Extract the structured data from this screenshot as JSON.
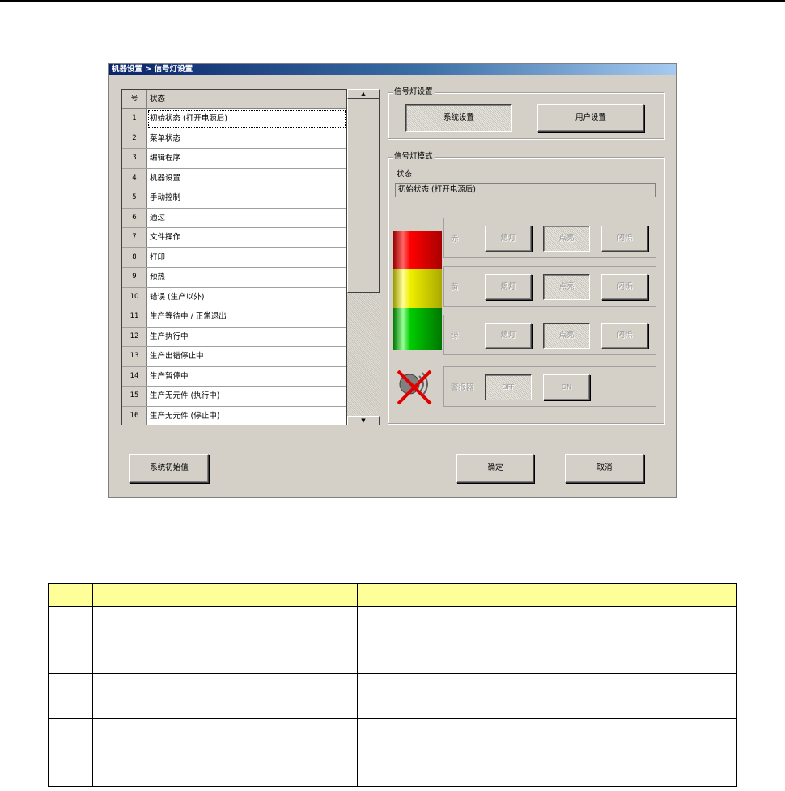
{
  "dialog": {
    "title": "机器设置 > 信号灯设置",
    "list": {
      "header_no": "号",
      "header_state": "状态",
      "rows": [
        {
          "no": "1",
          "state": "初始状态 (打开电源后)"
        },
        {
          "no": "2",
          "state": "菜单状态"
        },
        {
          "no": "3",
          "state": "编辑程序"
        },
        {
          "no": "4",
          "state": "机器设置"
        },
        {
          "no": "5",
          "state": "手动控制"
        },
        {
          "no": "6",
          "state": "通过"
        },
        {
          "no": "7",
          "state": "文件操作"
        },
        {
          "no": "8",
          "state": "打印"
        },
        {
          "no": "9",
          "state": "预热"
        },
        {
          "no": "10",
          "state": "错误 (生产以外)"
        },
        {
          "no": "11",
          "state": "生产等待中 / 正常退出"
        },
        {
          "no": "12",
          "state": "生产执行中"
        },
        {
          "no": "13",
          "state": "生产出错停止中"
        },
        {
          "no": "14",
          "state": "生产暂停中"
        },
        {
          "no": "15",
          "state": "生产无元件 (执行中)"
        },
        {
          "no": "16",
          "state": "生产无元件 (停止中)"
        }
      ],
      "selected_index": 0
    },
    "signal_settings": {
      "legend": "信号灯设置",
      "system_button": "系统设置",
      "user_button": "用户设置"
    },
    "signal_mode": {
      "legend": "信号灯模式",
      "state_label": "状态",
      "state_value": "初始状态 (打开电源后)",
      "colors": [
        {
          "label": "赤",
          "off": "熄灯",
          "on": "点亮",
          "blink": "闪烁",
          "lamp_color": "#e60000"
        },
        {
          "label": "黄",
          "off": "熄灯",
          "on": "点亮",
          "blink": "闪烁",
          "lamp_color": "#e6e600"
        },
        {
          "label": "绿",
          "off": "熄灯",
          "on": "点亮",
          "blink": "闪烁",
          "lamp_color": "#00c000"
        }
      ],
      "buzzer": {
        "label": "警报器",
        "off": "OFF",
        "on": "ON"
      }
    },
    "footer": {
      "default_button": "系统初始值",
      "ok_button": "确定",
      "cancel_button": "取消"
    }
  },
  "doc_table": {
    "header": [
      "",
      "",
      ""
    ],
    "rows": [
      [
        "",
        "",
        ""
      ],
      [
        "",
        "",
        ""
      ],
      [
        "",
        "",
        ""
      ],
      [
        "",
        "",
        ""
      ]
    ]
  }
}
